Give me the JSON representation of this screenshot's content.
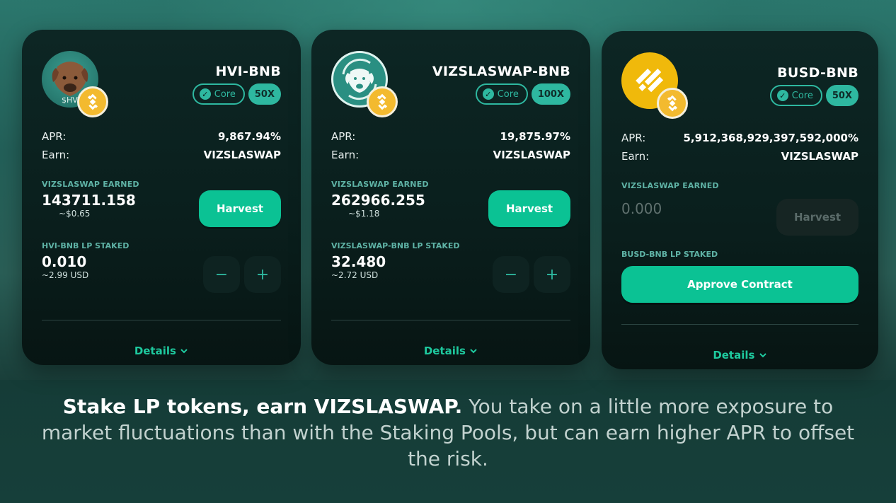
{
  "farms": [
    {
      "pair": "HVI-BNB",
      "avatar_text": "$HV",
      "core_label": "Core",
      "multiplier": "50X",
      "apr_label": "APR:",
      "apr": "9,867.94%",
      "earn_label": "Earn:",
      "earn": "VIZSLASWAP",
      "earned_label": "VIZSLASWAP EARNED",
      "earned_amount": "143711.158",
      "earned_usd": "~$0.65",
      "harvest_label": "Harvest",
      "staked_label": "HVI-BNB LP STAKED",
      "staked_amount": "0.010",
      "staked_usd": "~2.99 USD",
      "minus": "−",
      "plus": "+",
      "details_label": "Details"
    },
    {
      "pair": "VIZSLASWAP-BNB",
      "core_label": "Core",
      "multiplier": "100X",
      "apr_label": "APR:",
      "apr": "19,875.97%",
      "earn_label": "Earn:",
      "earn": "VIZSLASWAP",
      "earned_label": "VIZSLASWAP EARNED",
      "earned_amount": "262966.255",
      "earned_usd": "~$1.18",
      "harvest_label": "Harvest",
      "staked_label": "VIZSLASWAP-BNB LP STAKED",
      "staked_amount": "32.480",
      "staked_usd": "~2.72 USD",
      "minus": "−",
      "plus": "+",
      "details_label": "Details"
    },
    {
      "pair": "BUSD-BNB",
      "core_label": "Core",
      "multiplier": "50X",
      "apr_label": "APR:",
      "apr": "5,912,368,929,397,592,000%",
      "earn_label": "Earn:",
      "earn": "VIZSLASWAP",
      "earned_label": "VIZSLASWAP EARNED",
      "earned_amount": "0.000",
      "harvest_label": "Harvest",
      "staked_label": "BUSD-BNB LP STAKED",
      "approve_label": "Approve Contract",
      "details_label": "Details"
    }
  ],
  "caption": {
    "bold": "Stake LP tokens, earn VIZSLASWAP.",
    "rest": " You take on a little more exposure to market fluctuations than with the Staking Pools, but can earn higher APR to offset the risk."
  },
  "colors": {
    "accent": "#0bc294",
    "tag": "#2eb8a0",
    "bnb": "#f3ba2f",
    "busd": "#f0b90b"
  },
  "icons": [
    "hvi-token-icon",
    "vizslaswap-token-icon",
    "busd-token-icon",
    "bnb-icon",
    "core-check-icon",
    "chevron-down-icon"
  ]
}
